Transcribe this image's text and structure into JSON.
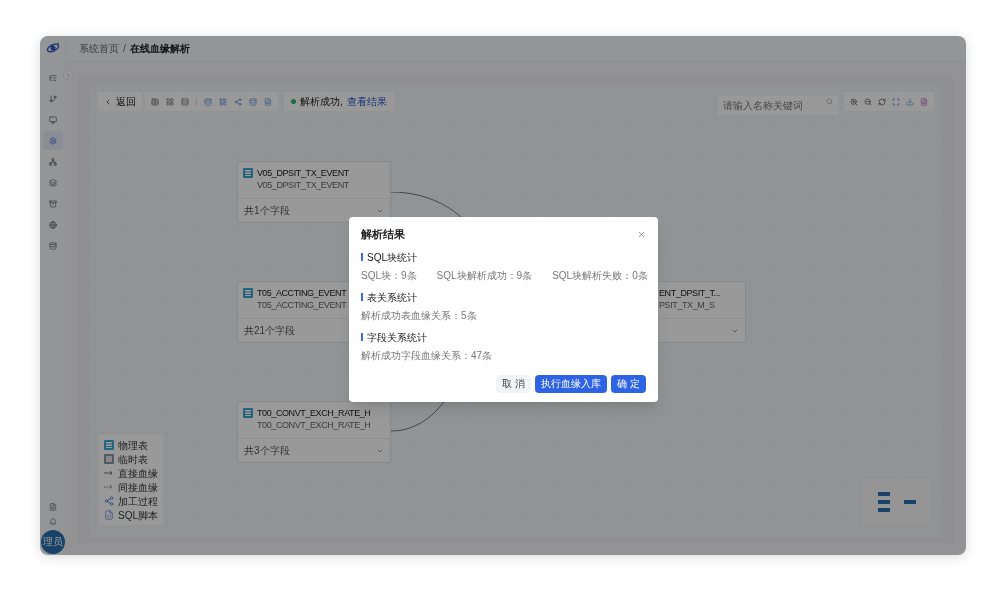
{
  "breadcrumb": {
    "items": [
      "系统首页",
      "在线血缘解析"
    ],
    "separator": "/"
  },
  "sidebar": {
    "items": [
      {
        "selected": false
      },
      {
        "selected": false
      },
      {
        "selected": false
      },
      {
        "selected": true
      },
      {
        "selected": false
      },
      {
        "selected": false
      },
      {
        "selected": false
      },
      {
        "selected": false
      },
      {
        "selected": false
      }
    ],
    "avatar": "理员"
  },
  "toolbar": {
    "back": "返回",
    "status": "解析成功,",
    "status_link": "查看结果",
    "search": {
      "placeholder": "请输入名称关键词"
    }
  },
  "nodes": [
    {
      "title": "V05_DPSIT_TX_EVENT",
      "subtitle": "V05_DPSIT_TX_EVENT",
      "fields": "共1个字段"
    },
    {
      "title": "T05_ACCTING_EVENT",
      "subtitle": "T05_ACCTING_EVENT",
      "fields": "共21个字段"
    },
    {
      "title": "ENT_DPSIT_T...",
      "subtitle": "PSIT_TX_M_S"
    },
    {
      "title": "T00_CONVT_EXCH_RATE_H",
      "subtitle": "T00_CONVT_EXCH_RATE_H",
      "fields": "共3个字段"
    }
  ],
  "legend": [
    {
      "kind": "physical",
      "label": "物理表"
    },
    {
      "kind": "temp",
      "label": "临时表"
    },
    {
      "kind": "direct",
      "label": "直接血缘"
    },
    {
      "kind": "indirect",
      "label": "间接血缘"
    },
    {
      "kind": "process",
      "label": "加工过程"
    },
    {
      "kind": "sql",
      "label": "SQL脚本"
    }
  ],
  "dialog": {
    "title": "解析结果",
    "sections": [
      {
        "heading": "SQL块统计",
        "stats": [
          "SQL块：9条",
          "SQL块解析成功：9条",
          "SQL块解析失败：0条"
        ]
      },
      {
        "heading": "表关系统计",
        "stats": [
          "解析成功表血缘关系：5条"
        ]
      },
      {
        "heading": "字段关系统计",
        "stats": [
          "解析成功字段血缘关系：47条"
        ]
      }
    ],
    "buttons": [
      {
        "label": "取 消",
        "kind": "default"
      },
      {
        "label": "执行血缘入库",
        "kind": "primary"
      },
      {
        "label": "确 定",
        "kind": "primary"
      }
    ]
  }
}
